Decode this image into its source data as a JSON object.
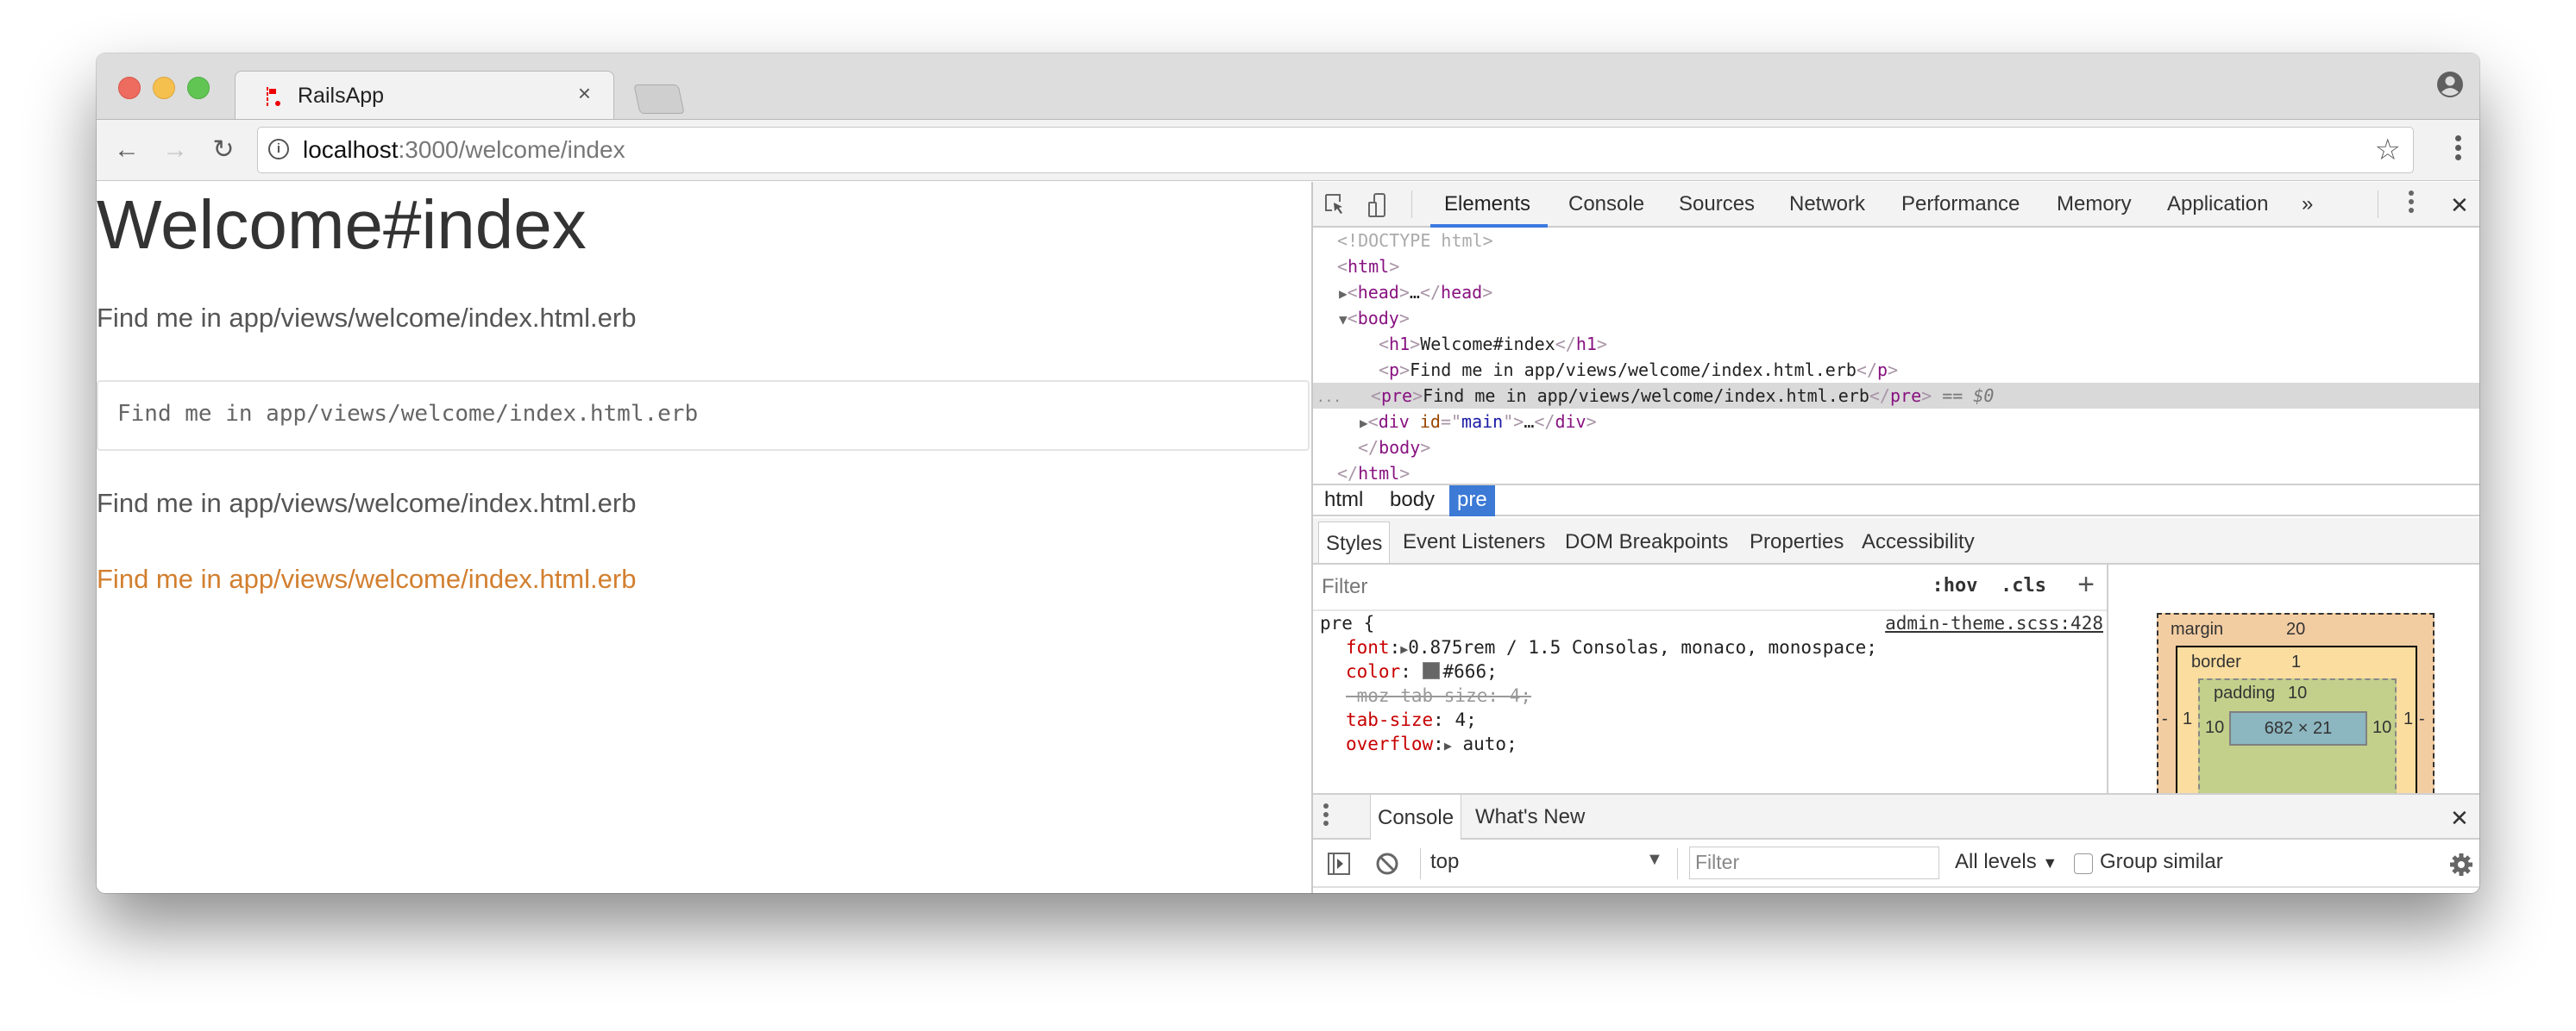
{
  "browser": {
    "tab_title": "RailsApp",
    "tab_close": "×",
    "url_host": "localhost",
    "url_rest": ":3000/welcome/index",
    "icons": {
      "back": "back-arrow-icon",
      "forward": "forward-arrow-icon",
      "reload": "reload-icon",
      "info": "info-icon",
      "bookmark": "star-icon",
      "menu": "kebab-menu-icon",
      "profile": "profile-icon"
    },
    "glyphs": {
      "back": "←",
      "forward": "→",
      "reload": "↻",
      "info": "i",
      "star": "☆"
    }
  },
  "page": {
    "heading": "Welcome#index",
    "paragraph_1": "Find me in app/views/welcome/index.html.erb",
    "pre_text": "Find me in app/views/welcome/index.html.erb",
    "paragraph_2": "Find me in app/views/welcome/index.html.erb",
    "paragraph_3": "Find me in app/views/welcome/index.html.erb",
    "accent_color": "#d27f2f"
  },
  "devtools": {
    "tabs": [
      "Elements",
      "Console",
      "Sources",
      "Network",
      "Performance",
      "Memory",
      "Application"
    ],
    "active_tab": "Elements",
    "more_tabs": "»",
    "close": "✕",
    "dom": {
      "doctype": "<!DOCTYPE html>",
      "html_open": "html",
      "head": "head",
      "ellipsis": "…",
      "body": "body",
      "h1_text": "Welcome#index",
      "p_text": "Find me in app/views/welcome/index.html.erb",
      "pre_text": "Find me in app/views/welcome/index.html.erb",
      "selected_marker": "== $0",
      "row_dots": "...",
      "div_tag": "div",
      "div_attr": "id",
      "div_attr_value": "main"
    },
    "breadcrumbs": [
      "html",
      "body",
      "pre"
    ],
    "breadcrumb_selected": "pre",
    "style_tabs": [
      "Styles",
      "Event Listeners",
      "DOM Breakpoints",
      "Properties",
      "Accessibility"
    ],
    "styles": {
      "filter_placeholder": "Filter",
      "hov": ":hov",
      "cls": ".cls",
      "add": "+",
      "selector": "pre {",
      "source": "admin-theme.scss:428",
      "declarations": [
        {
          "prop": "font",
          "value": "0.875rem / 1.5 Consolas, monaco, monospace;",
          "expandable": true,
          "struck": false
        },
        {
          "prop": "color",
          "value": "#666;",
          "swatch": "#666666",
          "struck": false
        },
        {
          "prop": "-moz-tab-size",
          "value": "4;",
          "struck": true
        },
        {
          "prop": "tab-size",
          "value": "4;",
          "struck": false
        },
        {
          "prop": "overflow",
          "value": "auto;",
          "expandable": true,
          "struck": false
        }
      ]
    },
    "box_model": {
      "margin_label": "margin",
      "margin": "20",
      "border_label": "border",
      "border": "1",
      "padding_label": "padding",
      "padding": "10",
      "content": "682 × 21",
      "left_margin": "-",
      "right_margin": "-",
      "left_border": "1",
      "right_border": "1",
      "left_padding": "10",
      "right_padding": "10"
    },
    "drawer": {
      "tabs": [
        "Console",
        "What's New"
      ],
      "active_tab": "Console",
      "close": "✕",
      "context": "top",
      "filter_placeholder": "Filter",
      "levels": "All levels",
      "group_similar": "Group similar",
      "group_similar_checked": false,
      "prompt": "›"
    }
  }
}
